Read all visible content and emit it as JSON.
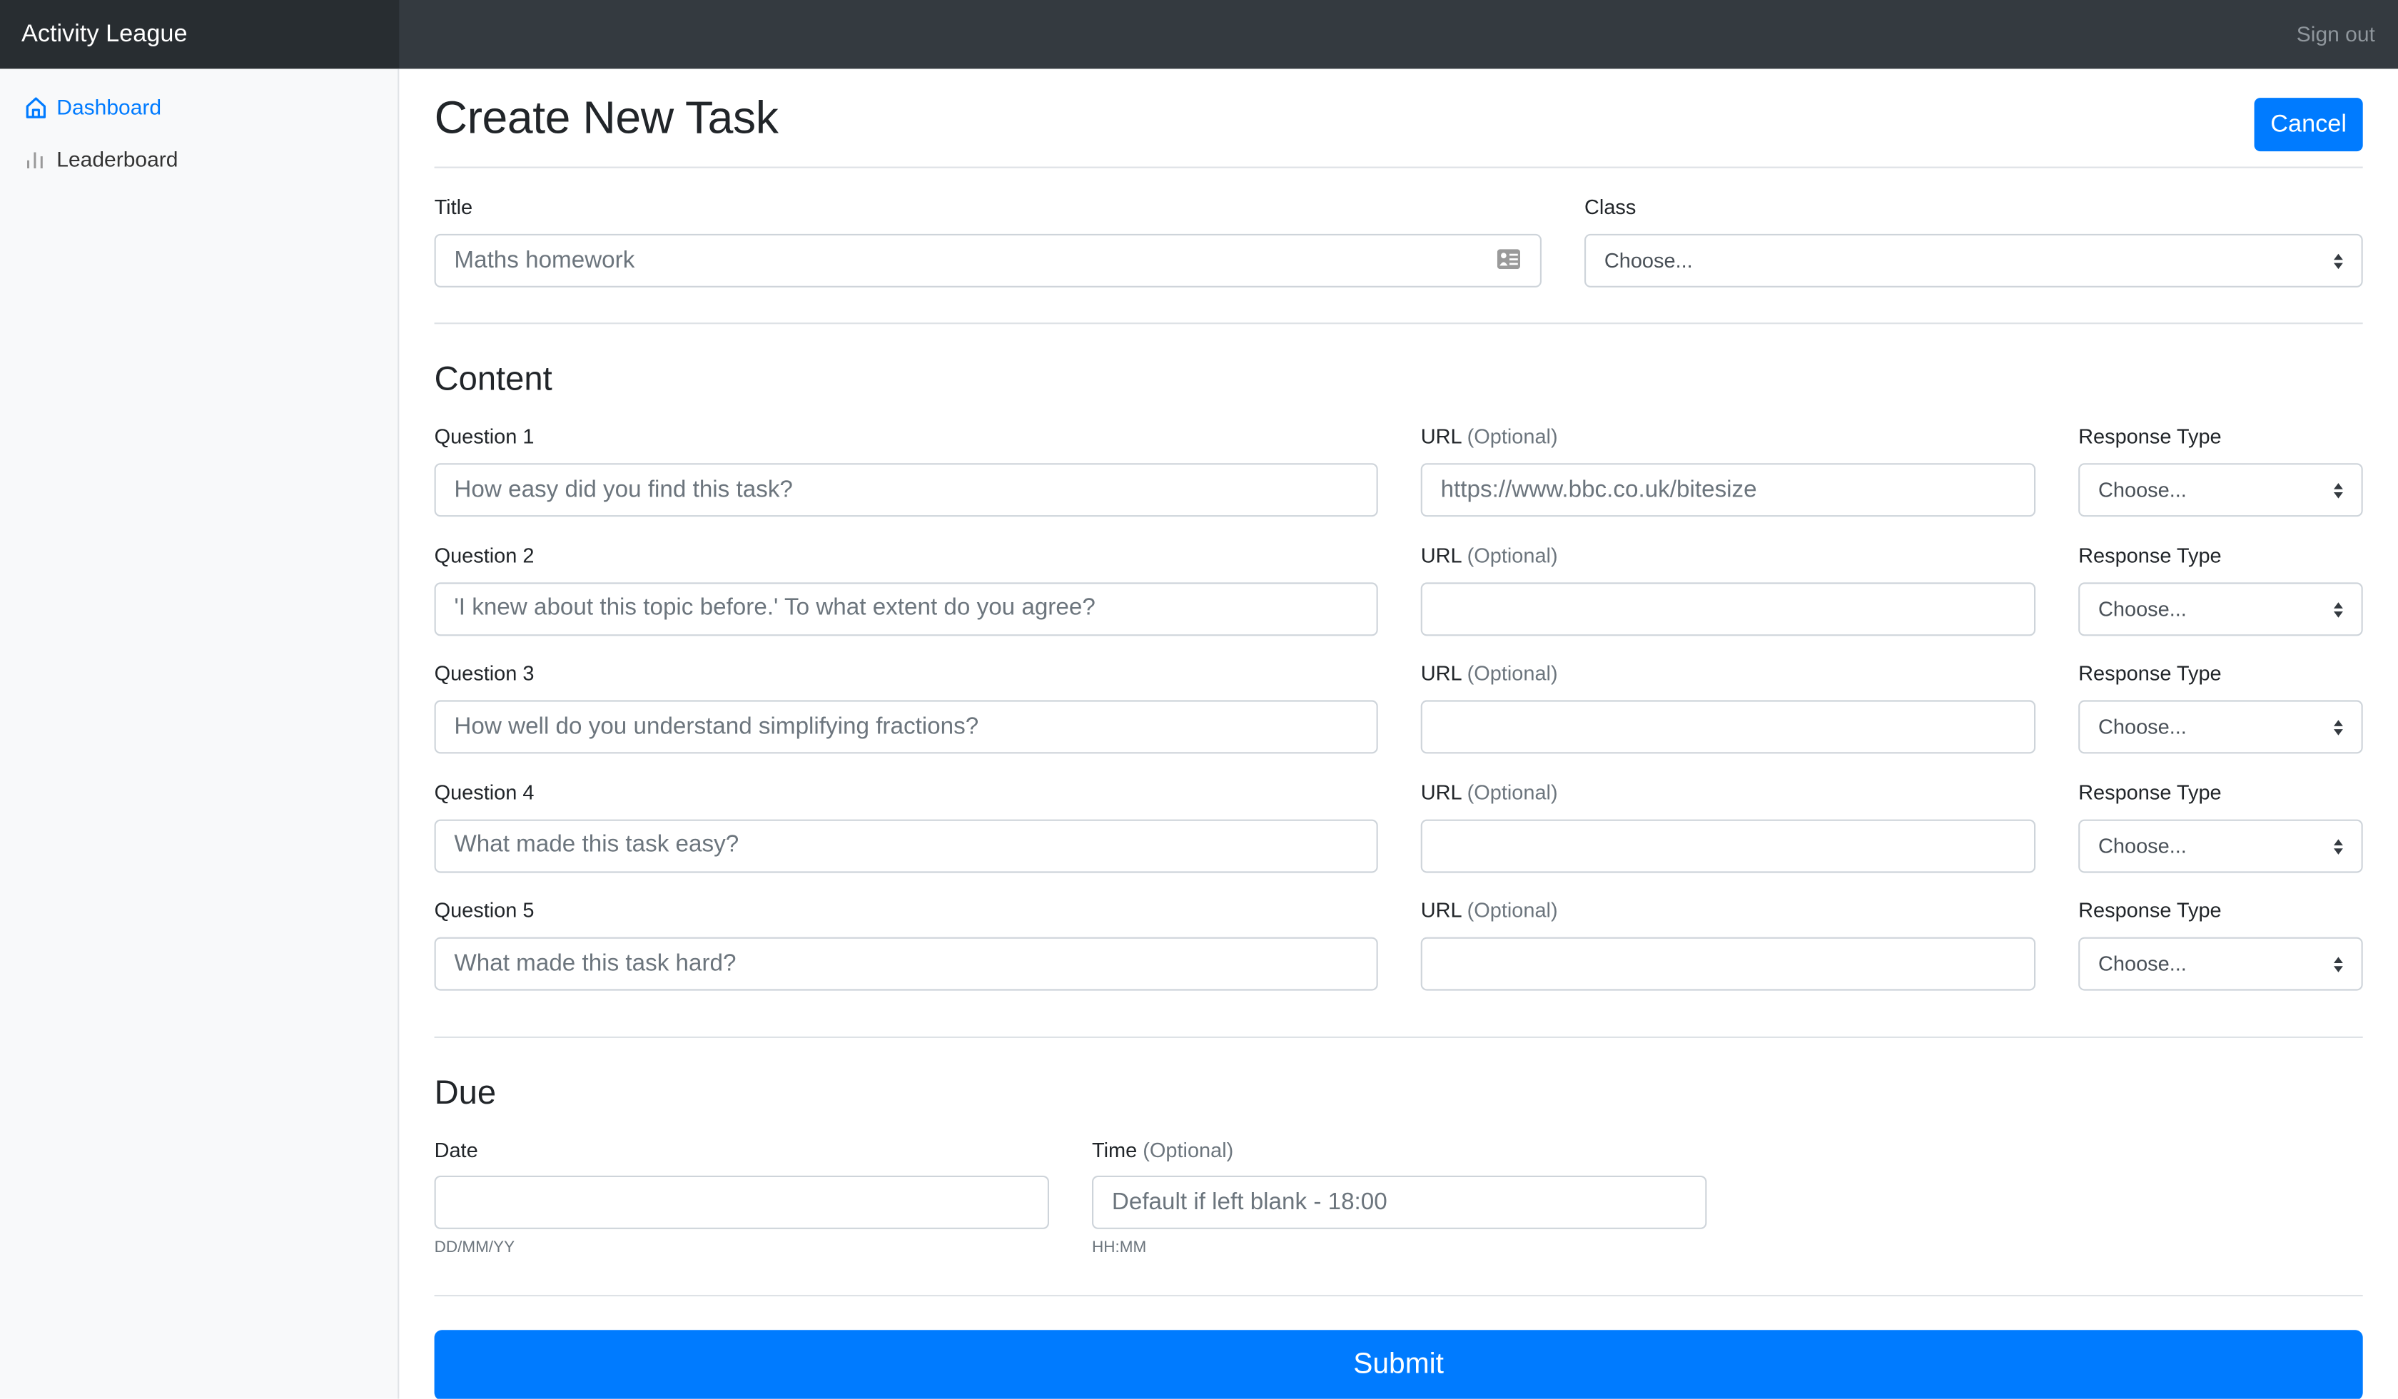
{
  "header": {
    "brand": "Activity League",
    "sign_out": "Sign out"
  },
  "sidebar": {
    "items": [
      {
        "label": "Dashboard",
        "icon": "home-icon",
        "active": true
      },
      {
        "label": "Leaderboard",
        "icon": "bar-chart-icon",
        "active": false
      }
    ]
  },
  "page": {
    "title": "Create New Task",
    "cancel_label": "Cancel"
  },
  "form": {
    "title_label": "Title",
    "title_placeholder": "Maths homework",
    "title_value": "",
    "class_label": "Class",
    "class_selected": "Choose...",
    "content_heading": "Content",
    "url_label": "URL",
    "optional_suffix": "(Optional)",
    "response_type_label": "Response Type",
    "questions": [
      {
        "label": "Question 1",
        "placeholder": "How easy did you find this task?",
        "url_placeholder": "https://www.bbc.co.uk/bitesize",
        "response_type": "Choose..."
      },
      {
        "label": "Question 2",
        "placeholder": "'I knew about this topic before.' To what extent do you agree?",
        "url_placeholder": "",
        "response_type": "Choose..."
      },
      {
        "label": "Question 3",
        "placeholder": "How well do you understand simplifying fractions?",
        "url_placeholder": "",
        "response_type": "Choose..."
      },
      {
        "label": "Question 4",
        "placeholder": "What made this task easy?",
        "url_placeholder": "",
        "response_type": "Choose..."
      },
      {
        "label": "Question 5",
        "placeholder": "What made this task hard?",
        "url_placeholder": "",
        "response_type": "Choose..."
      }
    ],
    "due_heading": "Due",
    "date_label": "Date",
    "date_placeholder": "",
    "date_help": "DD/MM/YY",
    "time_label": "Time",
    "time_placeholder": "Default if left blank - 18:00",
    "time_help": "HH:MM",
    "submit_label": "Submit"
  },
  "colors": {
    "primary": "#007bff",
    "topbar": "#343a40",
    "brand_bg": "#282d31",
    "sidebar_bg": "#f8f9fa"
  }
}
